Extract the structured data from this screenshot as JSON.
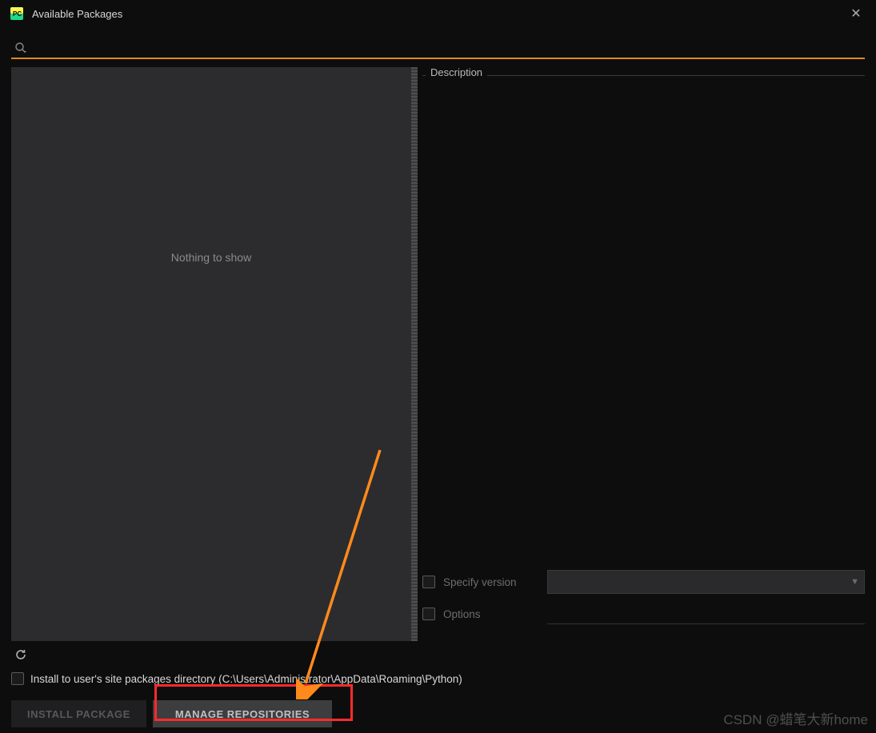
{
  "window": {
    "title": "Available Packages"
  },
  "search": {
    "value": ""
  },
  "left": {
    "empty_text": "Nothing to show"
  },
  "right": {
    "description_label": "Description",
    "specify_version_label": "Specify version",
    "version_value": "",
    "options_label": "Options",
    "options_value": ""
  },
  "footer": {
    "install_user_label": "Install to user's site packages directory (C:\\Users\\Administrator\\AppData\\Roaming\\Python)",
    "install_button": "INSTALL PACKAGE",
    "manage_button_prefix": "M",
    "manage_button_rest": "ANAGE REPOSITORIES"
  },
  "watermark": "CSDN @蜡笔大新home"
}
